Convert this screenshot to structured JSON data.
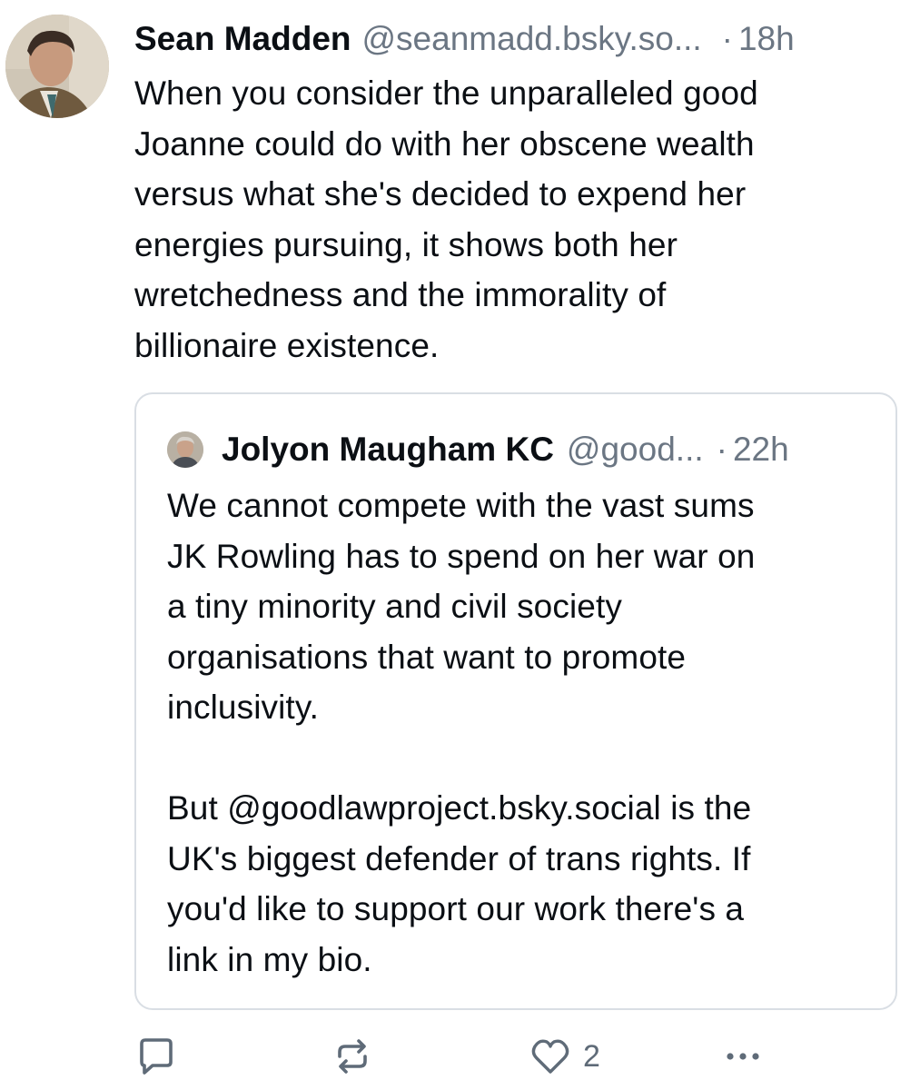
{
  "post": {
    "author_name": "Sean Madden",
    "author_handle": "@seanmadd.bsky.so...",
    "separator": "·",
    "time": "18h",
    "text": "When you consider the unparalleled good\nJoanne could do with her obscene wealth\nversus what she's decided to expend her\nenergies pursuing, it shows both her\nwretchedness and the immorality of\nbillionaire existence."
  },
  "quote": {
    "author_name": "Jolyon Maugham KC",
    "author_handle": "@good...",
    "separator": "·",
    "time": "22h",
    "text": "We cannot compete with the vast sums\nJK Rowling has to spend on her war on\na tiny minority and civil society\norganisations that want to promote\ninclusivity.\n\nBut @goodlawproject.bsky.social is the\nUK's biggest defender of trans rights. If\nyou'd like to support our work there's a\nlink in my bio."
  },
  "actions": {
    "reply_icon": "reply-icon",
    "repost_icon": "repost-icon",
    "like_icon": "heart-icon",
    "like_count": "2",
    "more_icon": "more-icon"
  },
  "colors": {
    "text": "#0b0f14",
    "muted": "#6b7683",
    "border": "#d9dee4",
    "icon": "#5f6b78"
  }
}
